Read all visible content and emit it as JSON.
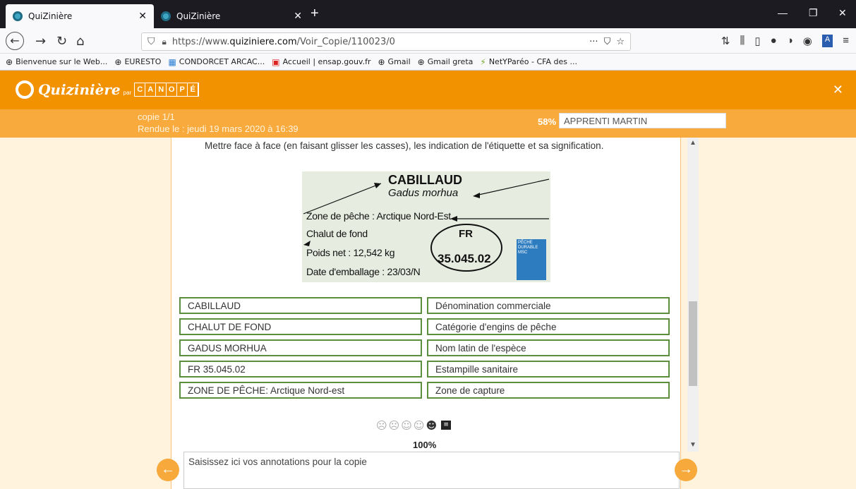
{
  "browser": {
    "tabs": [
      {
        "title": "QuiZinière",
        "active": true
      },
      {
        "title": "QuiZinière",
        "active": false
      }
    ],
    "url_prefix": "https://www.",
    "url_domain": "quiziniere.com",
    "url_path": "/Voir_Copie/110023/0",
    "bookmarks": [
      "Bienvenue sur le Web...",
      "EURESTO",
      "CONDORCET ARCAC...",
      "Accueil | ensap.gouv.fr",
      "Gmail",
      "Gmail greta",
      "NetYParéo - CFA des ..."
    ]
  },
  "app": {
    "brand": "Quizinière",
    "brand_par": "par",
    "canope_letters": [
      "C",
      "A",
      "N",
      "O",
      "P",
      "É"
    ],
    "copie": "copie 1/1",
    "rendue": "Rendue le : jeudi 19 mars 2020 à 16:39",
    "percent": "58%",
    "student": "APPRENTI MARTIN"
  },
  "question": {
    "instruction": "Mettre face à face (en faisant glisser les casses), les indication de l'étiquette et sa signification.",
    "label": {
      "name": "CABILLAUD",
      "latin": "Gadus morhua",
      "zone": "Zone de pêche : Arctique Nord-Est",
      "engin": "Chalut de fond",
      "poids": "Poids net : 12,542 kg",
      "date": "Date d'emballage : 23/03/N",
      "fr": "FR",
      "estampille": "35.045.02",
      "msc": "PÊCHE DURABLE MSC"
    },
    "pairs": [
      {
        "left": "CABILLAUD",
        "right": "Dénomination commerciale"
      },
      {
        "left": "CHALUT DE FOND",
        "right": "Catégorie d'engins de pêche"
      },
      {
        "left": "GADUS MORHUA",
        "right": "Nom latin de l'espèce"
      },
      {
        "left": "FR 35.045.02",
        "right": "Estampille sanitaire"
      },
      {
        "left": "ZONE DE PÊCHE: Arctique Nord-est",
        "right": "Zone de capture"
      }
    ],
    "score": "100%"
  },
  "annotation_placeholder": "Saisissez ici vos annotations pour la copie"
}
